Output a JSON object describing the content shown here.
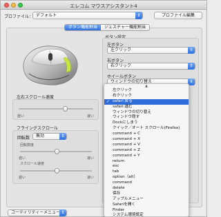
{
  "window": {
    "title": "エレコム マウスアシスタント4"
  },
  "toolbar": {
    "profile_label": "プロファイル：",
    "profile_value": "デフォルト",
    "edit_button": "プロファイル編集"
  },
  "tabs": [
    {
      "label": "ボタン機能割当"
    },
    {
      "label": "ジェスチャー機能割当"
    }
  ],
  "left": {
    "lr_scroll_label": "左右スクロール速度",
    "lr_slow": "遅い",
    "lr_fast": "速い",
    "flying_label": "フライングスクロール",
    "rotation_label": "回転数",
    "rotation_value": "無効",
    "rotation_count_label": "回転数度",
    "rot_slow": "遅い",
    "rot_fast": "速い",
    "scroll_speed_label": "スクロール速度",
    "sc_slow": "遅い",
    "sc_fast": "速い"
  },
  "right": {
    "section_label": "ボタン設定",
    "left_button_label": "左ボタン",
    "left_button_value": "左クリック",
    "right_button_label": "右ボタン",
    "right_button_value": "右クリック",
    "wheel_button_label": "ホイールボタン",
    "wheel_button_value": "ウィンドウの切り替え"
  },
  "menu": {
    "selected_index": 2,
    "items": [
      "左クリック",
      "右クリック",
      "safari:戻る",
      "safari:進む",
      "ウィンドウの切り替え",
      "ウィンドウ隠す",
      "Dockにしまう",
      "クイック／オート スクロール(Firefox)",
      "command + C",
      "command + X",
      "command + V",
      "command + Z",
      "command + Y",
      "return",
      "esc",
      "tab",
      "option（alt）",
      "command",
      "delete",
      "保存",
      "アップルメニュー",
      "Safariを開く",
      "Finder",
      "システム環境設定"
    ]
  },
  "footer": {
    "utility_label": "ユーティリティーメニュー"
  },
  "colors": {
    "accent": "#2e6bd8",
    "highlight": "#c8e63c"
  }
}
